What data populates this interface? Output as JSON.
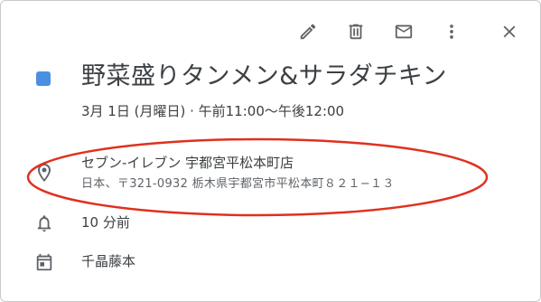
{
  "toolbar": {
    "edit_icon": "pencil-icon",
    "delete_icon": "trash-icon",
    "email_icon": "mail-icon",
    "more_icon": "more-vert-icon",
    "close_icon": "close-icon"
  },
  "event": {
    "color": "#4a90e2",
    "title": "野菜盛りタンメン&サラダチキン",
    "when": "3月 1日 (月曜日)  ·  午前11:00～午後12:00"
  },
  "location": {
    "icon": "location-pin-icon",
    "name": "セブン-イレブン 宇都宮平松本町店",
    "address": "日本、〒321-0932 栃木県宇都宮市平松本町８２１−１３"
  },
  "reminder": {
    "icon": "bell-icon",
    "text": "10 分前"
  },
  "calendar": {
    "icon": "calendar-icon",
    "name": "千晶藤本"
  },
  "annotation": {
    "shape": "ellipse",
    "color": "#e0301e"
  }
}
